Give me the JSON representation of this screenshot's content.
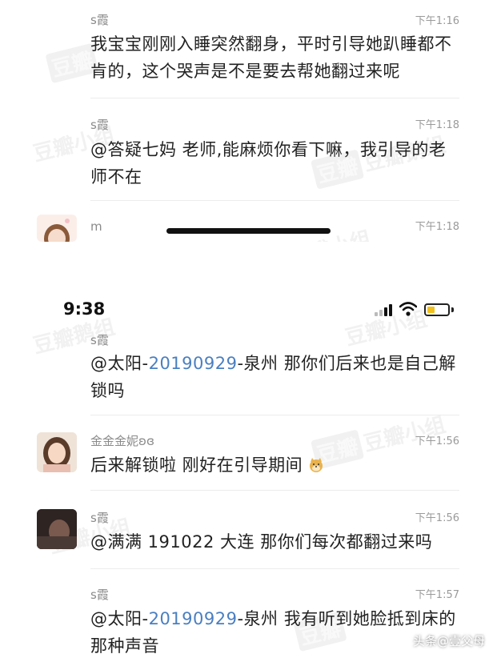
{
  "messages": [
    {
      "name": "s霞",
      "time": "下午1:16",
      "text": "我宝宝刚刚入睡突然翻身，平时引导她趴睡都不肯的，这个哭声是不是要去帮她翻过来呢"
    },
    {
      "name": "s霞",
      "time": "下午1:18",
      "text": "@答疑七妈 老师,能麻烦你看下嘛，我引导的老师不在"
    },
    {
      "name": "m",
      "time": "下午1:18"
    }
  ],
  "status_bar": {
    "clock": "9:38"
  },
  "messages_2": [
    {
      "name": "s霞",
      "mention": "@太阳-",
      "mention_num": "20190929",
      "rest": "-泉州 那你们后来也是自己解锁吗"
    },
    {
      "name": "金金金妮ʚɞ",
      "time": "下午1:56",
      "text": "后来解锁啦 刚好在引导期间"
    },
    {
      "name": "s霞",
      "time": "下午1:56",
      "text": "@满满 191022 大连 那你们每次都翻过来吗"
    },
    {
      "name": "s霞",
      "time": "下午1:57",
      "mention": "@太阳-",
      "mention_num": "20190929",
      "rest": "-泉州 我有听到她脸抵到床的那种声音"
    }
  ],
  "watermarks": [
    "豆瓣",
    "豆瓣小组",
    "豆瓣鹅组"
  ],
  "signature": "头条@壹父母",
  "colors": {
    "highlight": "#4a7fc1",
    "battery": "#f2c01c"
  }
}
